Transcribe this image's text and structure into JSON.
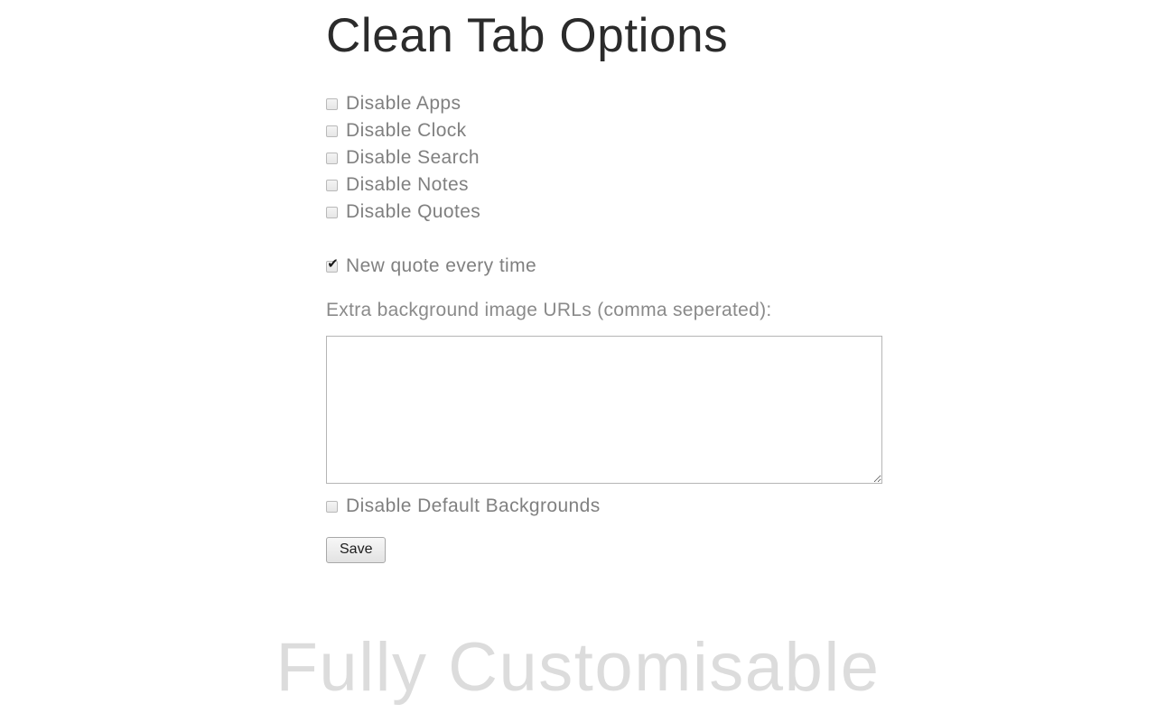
{
  "page": {
    "title": "Clean Tab Options",
    "background_color": "#ffffff",
    "text_color": "#808080",
    "title_color": "#2b2b2b",
    "caption_color": "#dcdcdc"
  },
  "options": {
    "feature_toggles": [
      {
        "label": "Disable Apps",
        "checked": false,
        "icon": "checkbox-unchecked-icon"
      },
      {
        "label": "Disable Clock",
        "checked": false,
        "icon": "checkbox-unchecked-icon"
      },
      {
        "label": "Disable Search",
        "checked": false,
        "icon": "checkbox-unchecked-icon"
      },
      {
        "label": "Disable Notes",
        "checked": false,
        "icon": "checkbox-unchecked-icon"
      },
      {
        "label": "Disable Quotes",
        "checked": false,
        "icon": "checkbox-unchecked-icon"
      }
    ],
    "quote_option": {
      "label": "New quote every time",
      "checked": true,
      "icon": "checkbox-checked-icon",
      "check_glyph": "✔"
    },
    "backgrounds": {
      "urls_label": "Extra background image URLs (comma seperated):",
      "urls_value": "",
      "urls_placeholder": "",
      "disable_defaults": {
        "label": "Disable Default Backgrounds",
        "checked": false,
        "icon": "checkbox-unchecked-icon"
      }
    },
    "save_label": "Save"
  },
  "caption": {
    "text": "Fully Customisable"
  }
}
